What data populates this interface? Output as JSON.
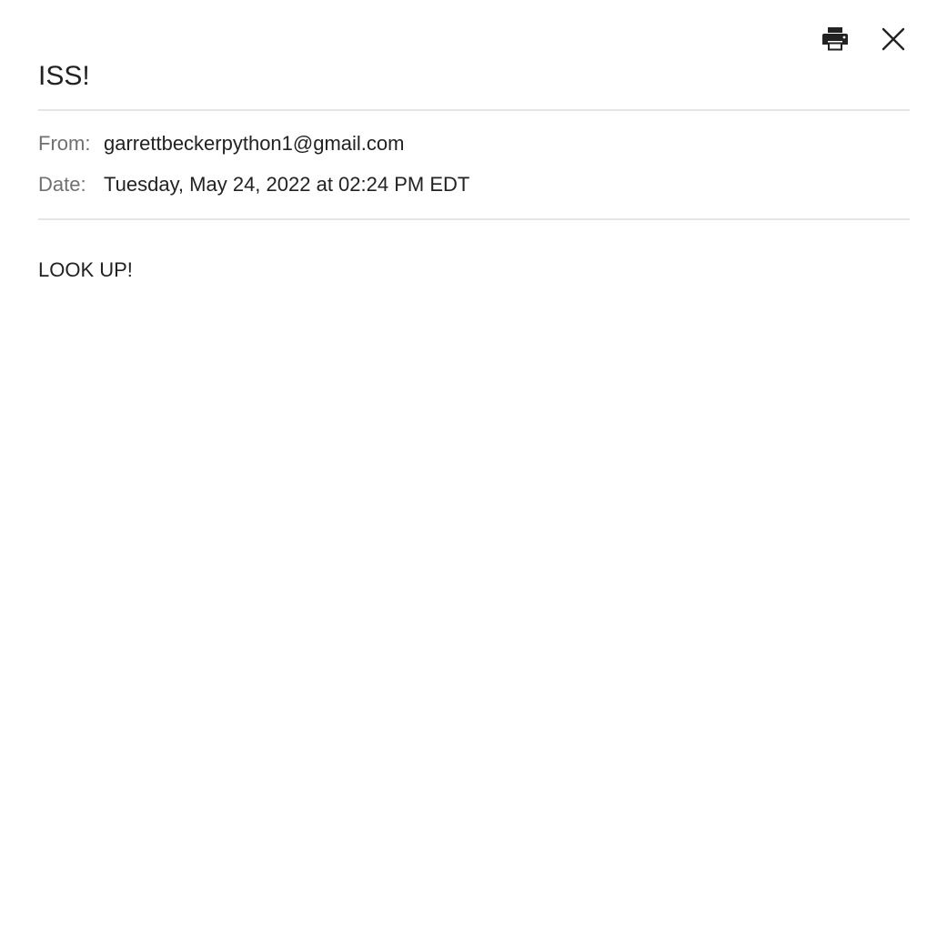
{
  "toolbar": {
    "print_icon": "printer-icon",
    "close_icon": "close-icon"
  },
  "email": {
    "subject": "ISS!",
    "from_label": "From:",
    "from_value": "garrettbeckerpython1@gmail.com",
    "date_label": "Date:",
    "date_value": "Tuesday, May 24, 2022 at 02:24 PM EDT",
    "body": "LOOK UP!"
  },
  "colors": {
    "text": "#222222",
    "label": "#707070",
    "divider": "#e5e5e5",
    "background": "#ffffff"
  }
}
